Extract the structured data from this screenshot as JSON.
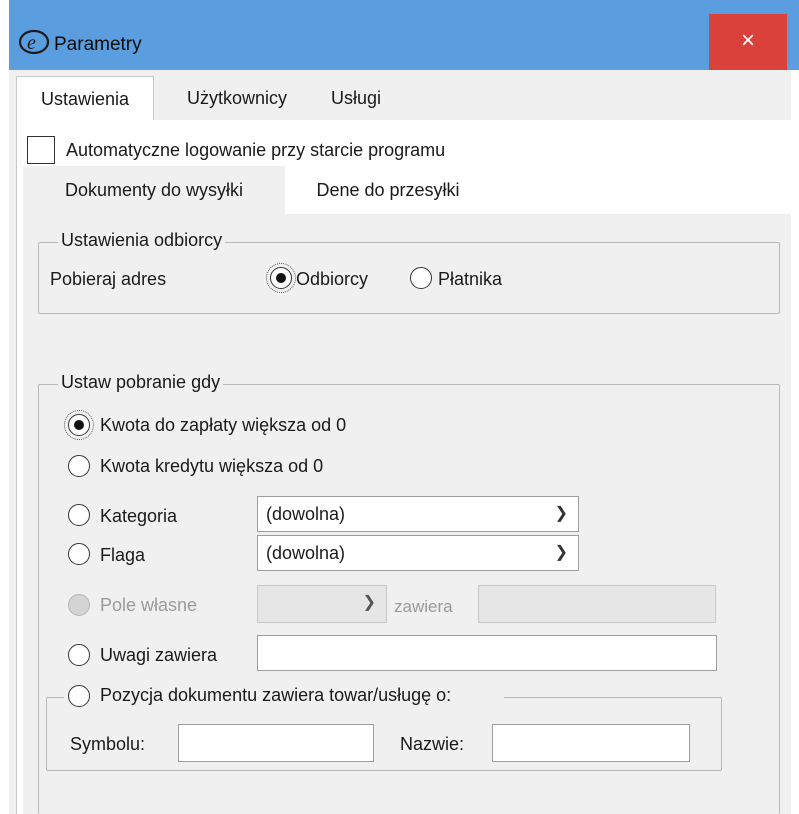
{
  "window": {
    "title": "Parametry",
    "close_label": "×"
  },
  "main_tabs": [
    {
      "label": "Ustawienia",
      "active": true
    },
    {
      "label": "Użytkownicy",
      "active": false
    },
    {
      "label": "Usługi",
      "active": false
    }
  ],
  "autologin": {
    "label": "Automatyczne logowanie przy starcie programu",
    "checked": false
  },
  "sub_tabs": [
    {
      "label": "Dokumenty do wysyłki",
      "active": false
    },
    {
      "label": "Dene do przesyłki",
      "active": true
    }
  ],
  "recipient_settings": {
    "legend": "Ustawienia odbiorcy",
    "label": "Pobieraj adres",
    "options": [
      {
        "label": "Odbiorcy",
        "selected": true
      },
      {
        "label": "Płatnika",
        "selected": false
      }
    ]
  },
  "cod_settings": {
    "legend": "Ustaw pobranie gdy",
    "options": {
      "amount": {
        "label": "Kwota do zapłaty większa od 0",
        "selected": true
      },
      "credit": {
        "label": "Kwota kredytu większa od 0",
        "selected": false
      },
      "category": {
        "label": "Kategoria",
        "selected": false,
        "value": "(dowolna)"
      },
      "flag": {
        "label": "Flaga",
        "selected": false,
        "value": "(dowolna)"
      },
      "custom_field": {
        "label": "Pole własne",
        "selected": false,
        "disabled": true,
        "value": "",
        "contains_label": "zawiera",
        "contains_value": ""
      },
      "notes": {
        "label": "Uwagi zawiera",
        "selected": false,
        "value": ""
      },
      "position": {
        "label": "Pozycja dokumentu zawiera towar/usługę o:",
        "selected": false,
        "symbol_label": "Symbolu:",
        "symbol_value": "",
        "name_label": "Nazwie:",
        "name_value": ""
      }
    }
  },
  "icons": {
    "app": "app-logo-icon",
    "dropdown": "chevron-down-icon"
  },
  "colors": {
    "titlebar": "#5a9ee0",
    "close": "#d9413a"
  }
}
